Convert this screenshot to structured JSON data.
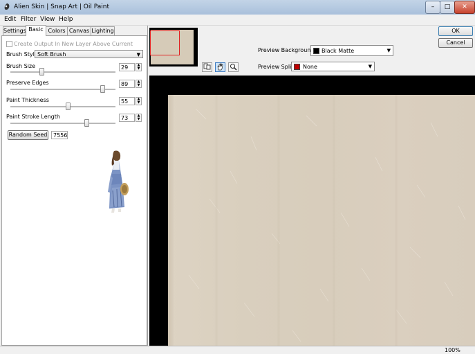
{
  "window": {
    "title": "Alien Skin | Snap Art | Oil Paint",
    "minimize_glyph": "–",
    "maximize_glyph": "□",
    "close_glyph": "✕"
  },
  "menu": [
    "Edit",
    "Filter",
    "View",
    "Help"
  ],
  "tabs": [
    {
      "label": "Settings",
      "active": false
    },
    {
      "label": "Basic",
      "active": true
    },
    {
      "label": "Colors",
      "active": false
    },
    {
      "label": "Canvas",
      "active": false
    },
    {
      "label": "Lighting",
      "active": false
    }
  ],
  "basic": {
    "create_output_label": "Create Output In New Layer Above Current",
    "create_output_checked": false,
    "brush_style_label": "Brush Style:",
    "brush_style_value": "Soft Brush",
    "sliders": [
      {
        "label": "Brush Size",
        "value": "29",
        "min": 0,
        "max": 100,
        "level": 29
      },
      {
        "label": "Preserve Edges",
        "value": "89",
        "min": 0,
        "max": 100,
        "level": 89
      },
      {
        "label": "Paint Thickness",
        "value": "55",
        "min": 0,
        "max": 100,
        "level": 55
      },
      {
        "label": "Paint Stroke Length",
        "value": "73",
        "min": 0,
        "max": 100,
        "level": 73
      }
    ],
    "random_seed_label": "Random Seed",
    "random_seed_value": "7556"
  },
  "toolbar": {
    "ok_label": "OK",
    "cancel_label": "Cancel",
    "preview_background_label": "Preview Background:",
    "preview_background_value": "Black Matte",
    "preview_background_color": "#000000",
    "preview_split_label": "Preview Split:",
    "preview_split_value": "None",
    "preview_split_color": "#c00000",
    "tools": [
      {
        "icon": "compare-icon",
        "active": false
      },
      {
        "icon": "hand-icon",
        "active": true
      },
      {
        "icon": "zoom-icon",
        "active": false
      }
    ]
  },
  "status": {
    "zoom": "100%"
  },
  "colors": {
    "canvas": "#d9cebe",
    "preview_bg": "#000000",
    "nav_rect": "#e02020"
  }
}
